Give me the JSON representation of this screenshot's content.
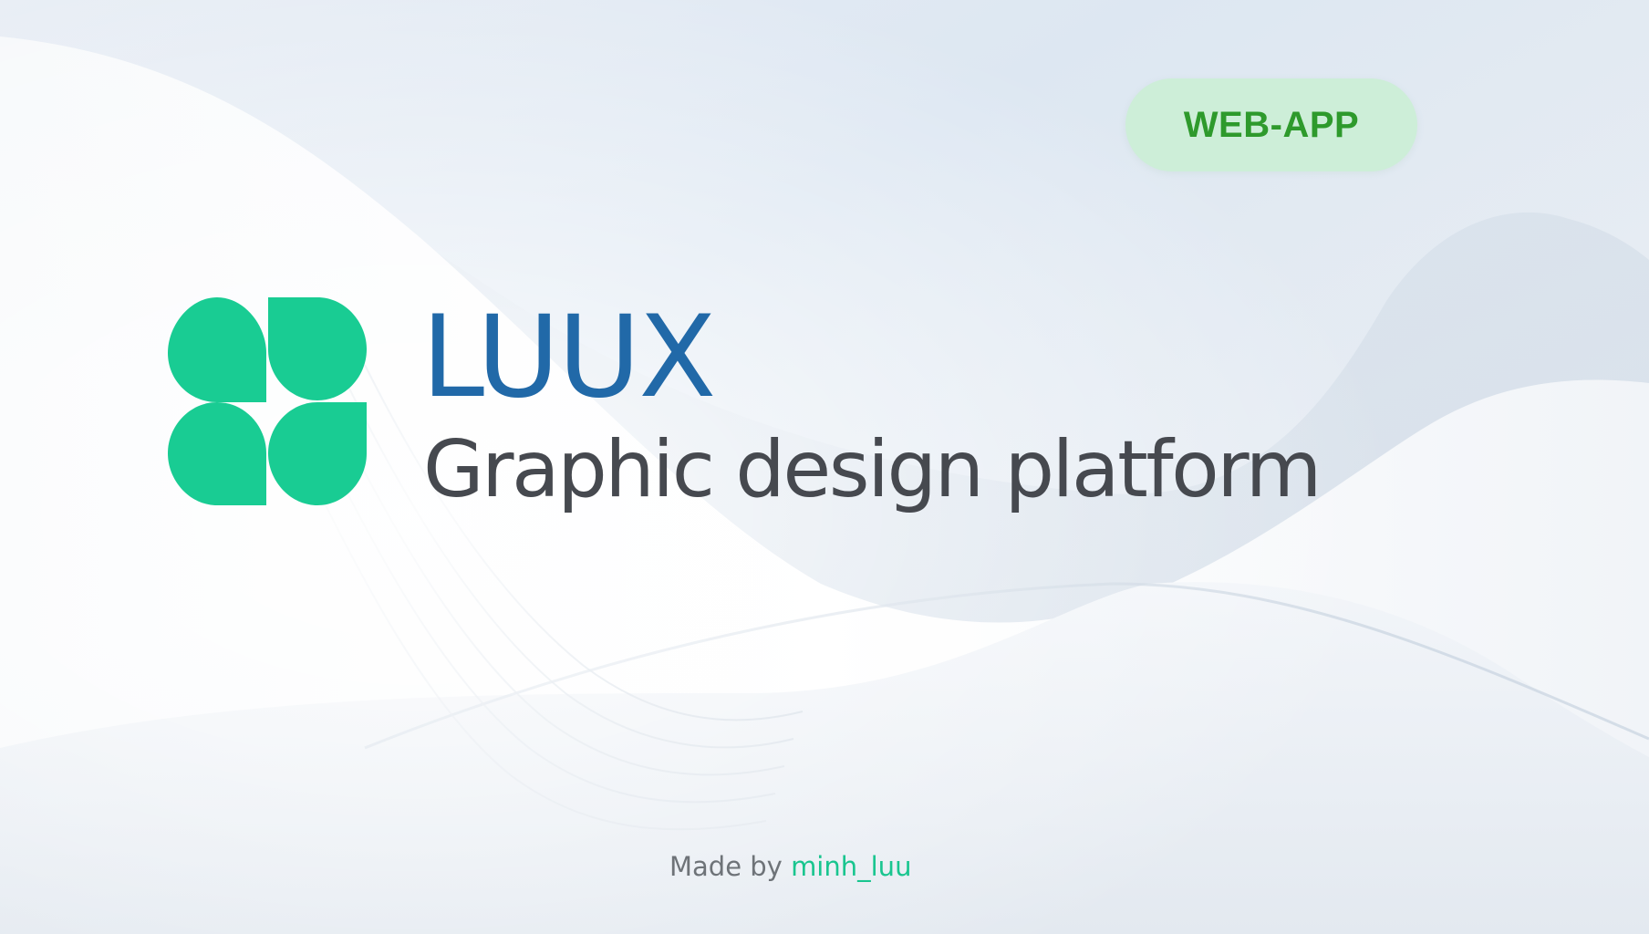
{
  "badge": {
    "label": "WEB-APP"
  },
  "brand": {
    "name": "LUUX",
    "tagline": "Graphic design platform",
    "logo_icon": "four-leaf-clover-icon"
  },
  "credit": {
    "prefix": "Made by",
    "author": "minh_luu"
  },
  "colors": {
    "brand_blue": "#2169a8",
    "logo_green": "#19cc93",
    "badge_background": "#cdeed8",
    "badge_text": "#2e9a2c",
    "tagline_gray": "#46494f",
    "author_green": "#19c58f"
  }
}
